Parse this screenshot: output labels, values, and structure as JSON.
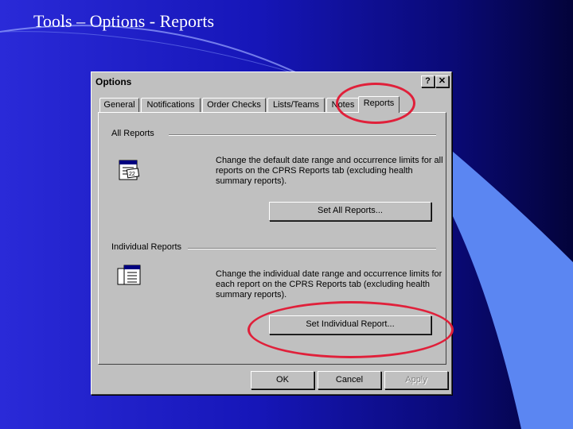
{
  "slide": {
    "title": "Tools – Options - Reports"
  },
  "dialog": {
    "title": "Options",
    "help_label": "?",
    "close_label": "✕",
    "tabs": [
      "General",
      "Notifications",
      "Order Checks",
      "Lists/Teams",
      "Notes",
      "Reports"
    ],
    "active_tab": "Reports",
    "all_reports": {
      "label": "All Reports",
      "description": "Change the default date range and occurrence limits for all reports on the CPRS Reports tab (excluding health summary reports).",
      "button": "Set All Reports..."
    },
    "individual_reports": {
      "label": "Individual Reports",
      "description": "Change the individual date range and occurrence limits for each report on the CPRS Reports tab (excluding health summary reports).",
      "button": "Set Individual Report..."
    },
    "buttons": {
      "ok": "OK",
      "cancel": "Cancel",
      "apply": "Apply"
    }
  },
  "colors": {
    "highlight": "#e0203a",
    "dialog_face": "#c0c0c0"
  }
}
